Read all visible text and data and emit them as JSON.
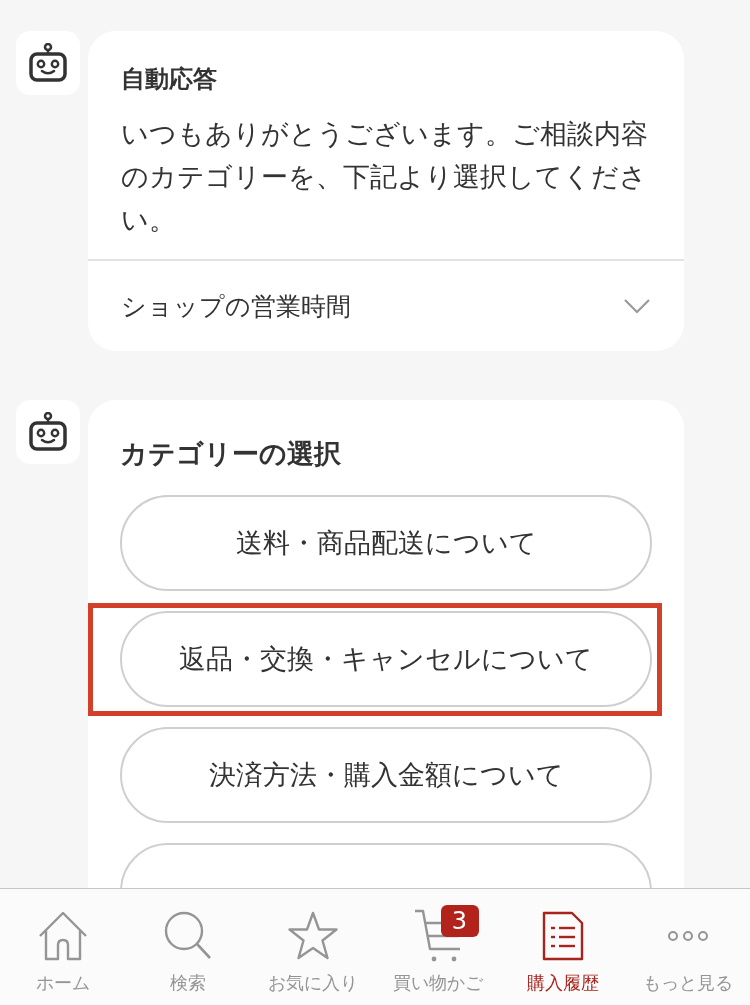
{
  "messages": [
    {
      "kind": "text",
      "title": "自動応答",
      "body": "いつもありがとうございます。ご相談内容のカテゴリーを、下記より選択してください。",
      "accordion": {
        "label": "ショップの営業時間",
        "expanded": false
      }
    },
    {
      "kind": "choices",
      "title": "カテゴリーの選択",
      "options": [
        {
          "label": "送料・商品配送について",
          "highlighted": false
        },
        {
          "label": "返品・交換・キャンセルについて",
          "highlighted": true
        },
        {
          "label": "決済方法・購入金額について",
          "highlighted": false
        },
        {
          "highlighted": false
        }
      ]
    }
  ],
  "tab_bar": {
    "items": [
      {
        "label": "ホーム",
        "selected": false
      },
      {
        "label": "検索",
        "selected": false
      },
      {
        "label": "お気に入り",
        "selected": false
      },
      {
        "label": "買い物かご",
        "selected": false,
        "badge": "3"
      },
      {
        "label": "購入履歴",
        "selected": true
      },
      {
        "label": "もっと見る",
        "selected": false
      }
    ]
  }
}
